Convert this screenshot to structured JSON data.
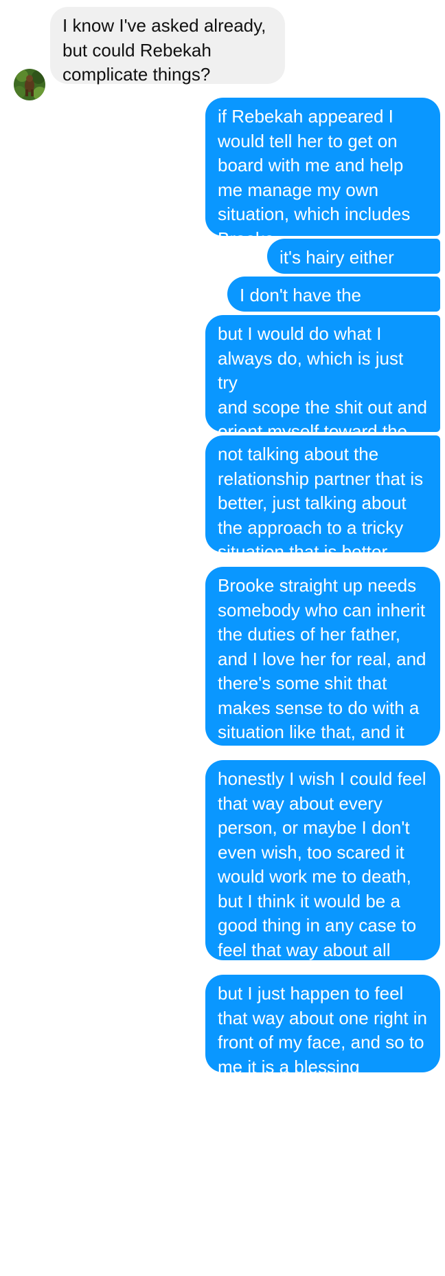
{
  "contact_avatar_icon": "profile-photo",
  "colors": {
    "incoming_bubble": "#f0f0f0",
    "outgoing_bubble": "#0a97ff"
  },
  "messages": [
    {
      "sender": "contact",
      "text": "I know I've asked already,\nbut could Rebekah\ncomplicate things?"
    },
    {
      "sender": "me",
      "text": "if Rebekah appeared I\nwould tell her to get on\nboard with me and help\nme manage my own\nsituation, which includes\nBrooke"
    },
    {
      "sender": "me",
      "text": "it's hairy either way"
    },
    {
      "sender": "me",
      "text": "I don't have the answers"
    },
    {
      "sender": "me",
      "text": "but I would do what I\nalways do, which is just try\nand scope the shit out and\norient myself toward the\nthing that was better"
    },
    {
      "sender": "me",
      "text": "not talking about the\nrelationship partner that is\nbetter, just talking about\nthe approach to a tricky\nsituation that is better"
    },
    {
      "sender": "me",
      "text": "Brooke straight up needs\nsomebody who can inherit\nthe duties of her father,\nand I love her for real, and\nthere's some shit that\nmakes sense to do with a\nsituation like that, and it\ntranscends the personal"
    },
    {
      "sender": "me",
      "text": "honestly I wish I could feel\nthat way about every\nperson, or maybe I don't\neven wish, too scared it\nwould work me to death,\nbut I think it would be a\ngood thing in any case to\nfeel that way about all\npeople, or more people"
    },
    {
      "sender": "me",
      "text": "but I just happen to feel\nthat way about one right in\nfront of my face, and so to\nme it is a blessing"
    }
  ]
}
